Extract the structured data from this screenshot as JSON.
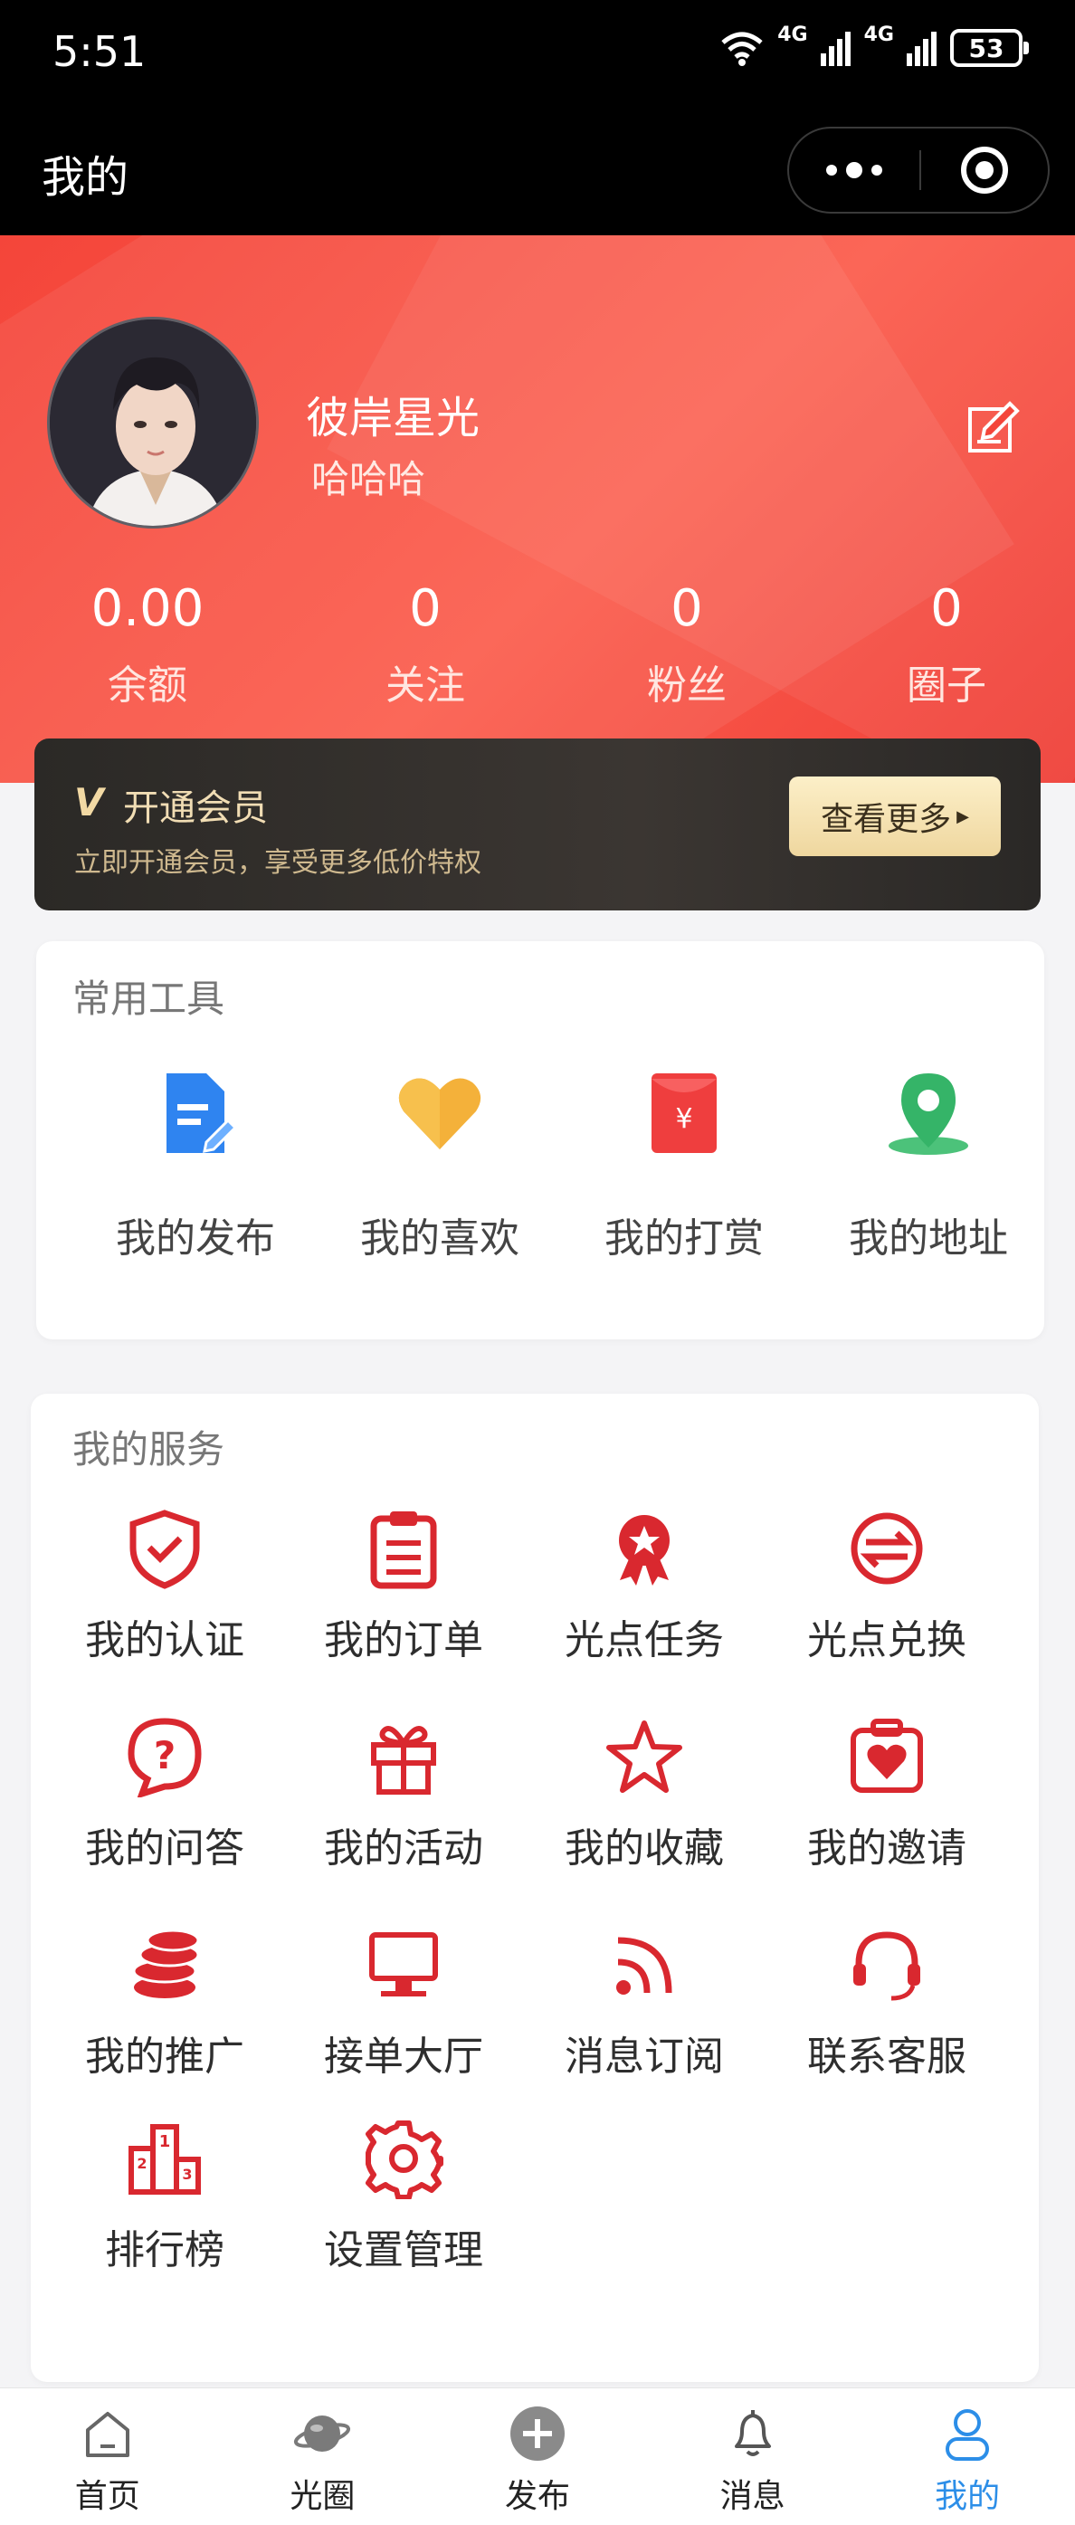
{
  "status_bar": {
    "time": "5:51",
    "net1": "4G",
    "net2": "4G",
    "battery": "53"
  },
  "nav": {
    "title": "我的"
  },
  "profile": {
    "name": "彼岸星光",
    "signature": "哈哈哈"
  },
  "stats": [
    {
      "value": "0.00",
      "label": "余额"
    },
    {
      "value": "0",
      "label": "关注"
    },
    {
      "value": "0",
      "label": "粉丝"
    },
    {
      "value": "0",
      "label": "圈子"
    }
  ],
  "vip": {
    "logo": "V",
    "title": "开通会员",
    "subtitle": "立即开通会员，享受更多低价特权",
    "button": "查看更多"
  },
  "tools": {
    "title": "常用工具",
    "items": [
      {
        "label": "我的发布",
        "icon": "document-edit-icon"
      },
      {
        "label": "我的喜欢",
        "icon": "heart-icon"
      },
      {
        "label": "我的打赏",
        "icon": "red-envelope-icon"
      },
      {
        "label": "我的地址",
        "icon": "location-pin-icon"
      }
    ]
  },
  "services": {
    "title": "我的服务",
    "items": [
      {
        "label": "我的认证",
        "icon": "shield-check-icon"
      },
      {
        "label": "我的订单",
        "icon": "clipboard-icon"
      },
      {
        "label": "光点任务",
        "icon": "award-icon"
      },
      {
        "label": "光点兑换",
        "icon": "exchange-icon"
      },
      {
        "label": "我的问答",
        "icon": "question-bubble-icon"
      },
      {
        "label": "我的活动",
        "icon": "gift-icon"
      },
      {
        "label": "我的收藏",
        "icon": "star-icon"
      },
      {
        "label": "我的邀请",
        "icon": "invite-heart-icon"
      },
      {
        "label": "我的推广",
        "icon": "coins-icon"
      },
      {
        "label": "接单大厅",
        "icon": "monitor-icon"
      },
      {
        "label": "消息订阅",
        "icon": "rss-icon"
      },
      {
        "label": "联系客服",
        "icon": "headset-icon"
      },
      {
        "label": "排行榜",
        "icon": "podium-icon"
      },
      {
        "label": "设置管理",
        "icon": "gear-icon"
      }
    ]
  },
  "tabbar": [
    {
      "label": "首页",
      "icon": "home-icon"
    },
    {
      "label": "光圈",
      "icon": "planet-icon"
    },
    {
      "label": "发布",
      "icon": "plus-circle-icon"
    },
    {
      "label": "消息",
      "icon": "bell-icon"
    },
    {
      "label": "我的",
      "icon": "user-icon",
      "active": true
    }
  ],
  "colors": {
    "hero": "#f4453a",
    "accent_red": "#d9282f",
    "tab_active": "#2c8ee8"
  }
}
